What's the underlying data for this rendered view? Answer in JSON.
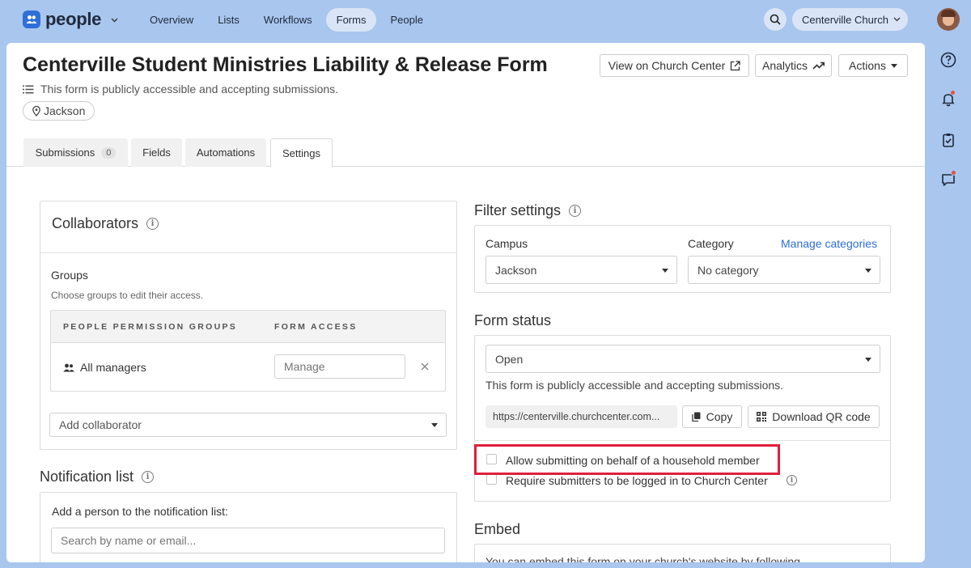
{
  "nav": {
    "app_name": "people",
    "links": [
      "Overview",
      "Lists",
      "Workflows",
      "Forms",
      "People"
    ],
    "active": "Forms",
    "org": "Centerville Church"
  },
  "header": {
    "title": "Centerville Student Ministries Liability & Release Form",
    "status_text": "This form is publicly accessible and accepting submissions.",
    "location": "Jackson",
    "view_button": "View on Church Center",
    "analytics_button": "Analytics",
    "actions_button": "Actions"
  },
  "tabs": [
    {
      "label": "Submissions",
      "count": "0"
    },
    {
      "label": "Fields"
    },
    {
      "label": "Automations"
    },
    {
      "label": "Settings"
    }
  ],
  "collaborators": {
    "title": "Collaborators",
    "groups_label": "Groups",
    "groups_hint": "Choose groups to edit their access.",
    "col_groups": "PEOPLE PERMISSION GROUPS",
    "col_access": "FORM ACCESS",
    "rows": [
      {
        "group": "All managers",
        "access_placeholder": "Manage"
      }
    ],
    "add_placeholder": "Add collaborator"
  },
  "notification": {
    "title": "Notification list",
    "add_label": "Add a person to the notification list:",
    "search_placeholder": "Search by name or email..."
  },
  "filter": {
    "title": "Filter settings",
    "campus_label": "Campus",
    "campus_value": "Jackson",
    "category_label": "Category",
    "manage_link": "Manage categories",
    "category_value": "No category"
  },
  "form_status": {
    "title": "Form status",
    "status_value": "Open",
    "status_text": "This form is publicly accessible and accepting submissions.",
    "url": "https://centerville.churchcenter.com...",
    "copy_button": "Copy",
    "qr_button": "Download QR code",
    "option_household": "Allow submitting on behalf of a household member",
    "option_login": "Require submitters to be logged in to Church Center"
  },
  "embed": {
    "title": "Embed",
    "text": "You can embed this form on your church's website by following"
  },
  "colors": {
    "background": "#a9c6ee",
    "accent": "#2c6ed5",
    "highlight": "#e01f3d",
    "notification_dot": "#e5533b"
  }
}
